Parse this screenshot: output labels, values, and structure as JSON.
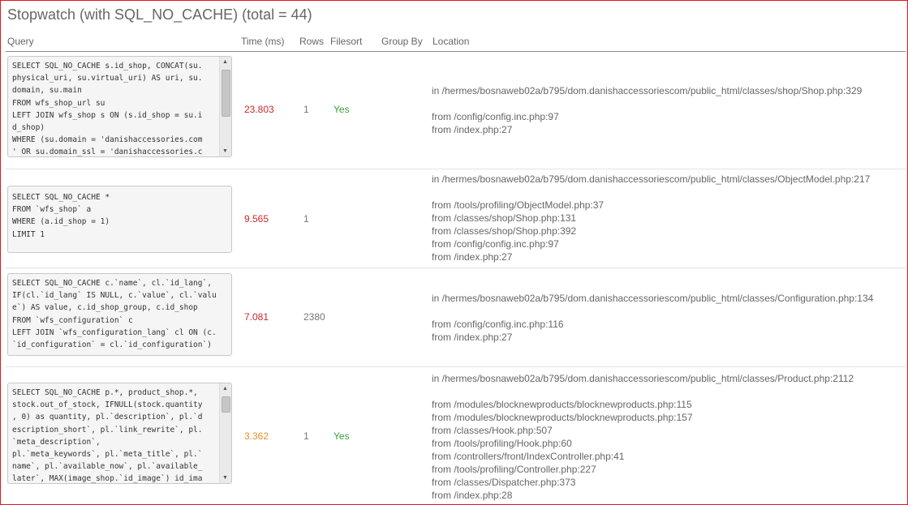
{
  "title": "Stopwatch (with SQL_NO_CACHE) (total = 44)",
  "columns": {
    "query": "Query",
    "time": "Time (ms)",
    "rows": "Rows",
    "filesort": "Filesort",
    "group_by": "Group By",
    "location": "Location"
  },
  "rows": [
    {
      "query": "SELECT SQL_NO_CACHE s.id_shop, CONCAT(su.\nphysical_uri, su.virtual_uri) AS uri, su.\ndomain, su.main\nFROM wfs_shop_url su\nLEFT JOIN wfs_shop s ON (s.id_shop = su.i\nd_shop)\nWHERE (su.domain = 'danishaccessories.com\n' OR su.domain_ssl = 'danishaccessories.c",
      "time": "23.803",
      "rows": "1",
      "filesort": "Yes",
      "group_by": "",
      "location_main": "in /hermes/bosnaweb02a/b795/dom.danishaccessoriescom/public_html/classes/shop/Shop.php:329",
      "location_from": [
        "from /config/config.inc.php:97",
        "from /index.php:27"
      ]
    },
    {
      "query": "SELECT SQL_NO_CACHE *\nFROM `wfs_shop` a\nWHERE (a.id_shop = 1)\nLIMIT 1",
      "time": "9.565",
      "rows": "1",
      "filesort": "",
      "group_by": "",
      "location_main": "in /hermes/bosnaweb02a/b795/dom.danishaccessoriescom/public_html/classes/ObjectModel.php:217",
      "location_from": [
        "from /tools/profiling/ObjectModel.php:37",
        "from /classes/shop/Shop.php:131",
        "from /classes/shop/Shop.php:392",
        "from /config/config.inc.php:97",
        "from /index.php:27"
      ]
    },
    {
      "query": "SELECT SQL_NO_CACHE c.`name`, cl.`id_lang`,\nIF(cl.`id_lang` IS NULL, c.`value`, cl.`valu\ne`) AS value, c.id_shop_group, c.id_shop\nFROM `wfs_configuration` c\nLEFT JOIN `wfs_configuration_lang` cl ON (c.\n`id_configuration` = cl.`id_configuration`)",
      "time": "7.081",
      "rows": "2380",
      "filesort": "",
      "group_by": "",
      "location_main": "in /hermes/bosnaweb02a/b795/dom.danishaccessoriescom/public_html/classes/Configuration.php:134",
      "location_from": [
        "from /config/config.inc.php:116",
        "from /index.php:27"
      ]
    },
    {
      "query": "SELECT SQL_NO_CACHE p.*, product_shop.*,\nstock.out_of_stock, IFNULL(stock.quantity\n, 0) as quantity, pl.`description`, pl.`d\nescription_short`, pl.`link_rewrite`, pl.\n`meta_description`,\npl.`meta_keywords`, pl.`meta_title`, pl.`\nname`, pl.`available_now`, pl.`available_\nlater`, MAX(image_shop.`id_image`) id_ima",
      "time": "3.362",
      "rows": "1",
      "filesort": "Yes",
      "group_by": "",
      "location_main": "in /hermes/bosnaweb02a/b795/dom.danishaccessoriescom/public_html/classes/Product.php:2112",
      "location_from": [
        "from /modules/blocknewproducts/blocknewproducts.php:115",
        "from /modules/blocknewproducts/blocknewproducts.php:157",
        "from /classes/Hook.php:507",
        "from /tools/profiling/Hook.php:60",
        "from /controllers/front/IndexController.php:41",
        "from /tools/profiling/Controller.php:227",
        "from /classes/Dispatcher.php:373",
        "from /index.php:28"
      ]
    }
  ]
}
